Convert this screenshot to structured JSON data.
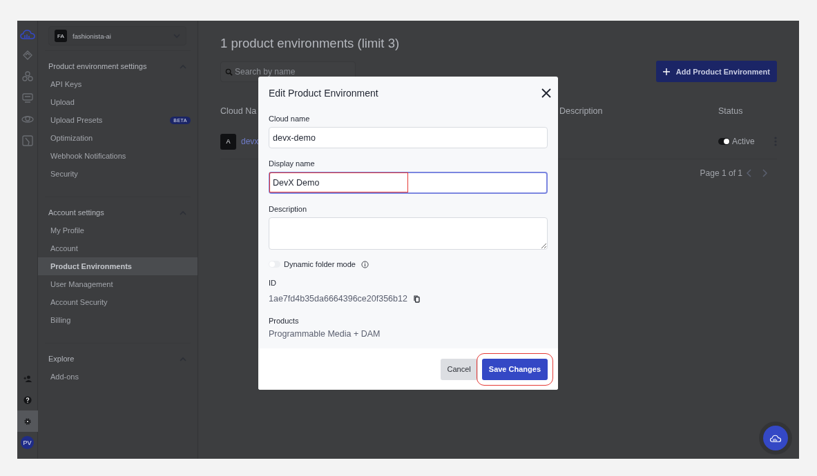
{
  "rail": {
    "bottom_items": [
      {
        "selected": false
      },
      {
        "selected": false
      },
      {
        "selected": true
      }
    ],
    "avatar": "PV"
  },
  "sidebar": {
    "account": {
      "initials": "FA",
      "name": "fashionista-ai"
    },
    "sections": [
      {
        "title": "Product environment settings",
        "expanded": true,
        "items": [
          {
            "label": "API Keys",
            "selected": false
          },
          {
            "label": "Upload",
            "selected": false
          },
          {
            "label": "Upload Presets",
            "selected": false,
            "badge": "BETA"
          },
          {
            "label": "Optimization",
            "selected": false
          },
          {
            "label": "Webhook Notifications",
            "selected": false
          },
          {
            "label": "Security",
            "selected": false
          }
        ]
      },
      {
        "title": "Account settings",
        "expanded": true,
        "items": [
          {
            "label": "My Profile",
            "selected": false
          },
          {
            "label": "Account",
            "selected": false
          },
          {
            "label": "Product Environments",
            "selected": true
          },
          {
            "label": "User Management",
            "selected": false
          },
          {
            "label": "Account Security",
            "selected": false
          },
          {
            "label": "Billing",
            "selected": false
          }
        ]
      },
      {
        "title": "Explore",
        "expanded": true,
        "items": [
          {
            "label": "Add-ons",
            "selected": false
          }
        ]
      }
    ]
  },
  "main": {
    "title": "1 product environments (limit 3)",
    "search": {
      "placeholder": "Search by name"
    },
    "add_button": "Add Product Environment",
    "table": {
      "columns": [
        "Cloud Na",
        "Description",
        "Status"
      ],
      "rows": [
        {
          "avatar": "A",
          "cloud_name": "devx",
          "status": "Active",
          "active": true
        }
      ]
    },
    "pagination": "Page 1 of 1"
  },
  "dialog": {
    "title": "Edit Product Environment",
    "fields": [
      {
        "kind": "text",
        "label": "Cloud name",
        "value": "devx-demo",
        "focused": false,
        "highlighted": false
      },
      {
        "kind": "text",
        "label": "Display name",
        "value": "DevX Demo",
        "focused": true,
        "highlighted": true
      },
      {
        "kind": "textarea",
        "label": "Description",
        "focused": false,
        "highlighted": false
      }
    ],
    "toggle": {
      "label": "Dynamic folder mode",
      "on": false
    },
    "id": {
      "label": "ID",
      "value": "1ae7fd4b35da6664396ce20f356b12"
    },
    "products": {
      "label": "Products",
      "value": "Programmable Media + DAM"
    },
    "buttons": [
      {
        "label": "Cancel",
        "kind": "secondary",
        "highlighted": false
      },
      {
        "label": "Save Changes",
        "kind": "primary",
        "highlighted": true
      }
    ]
  }
}
